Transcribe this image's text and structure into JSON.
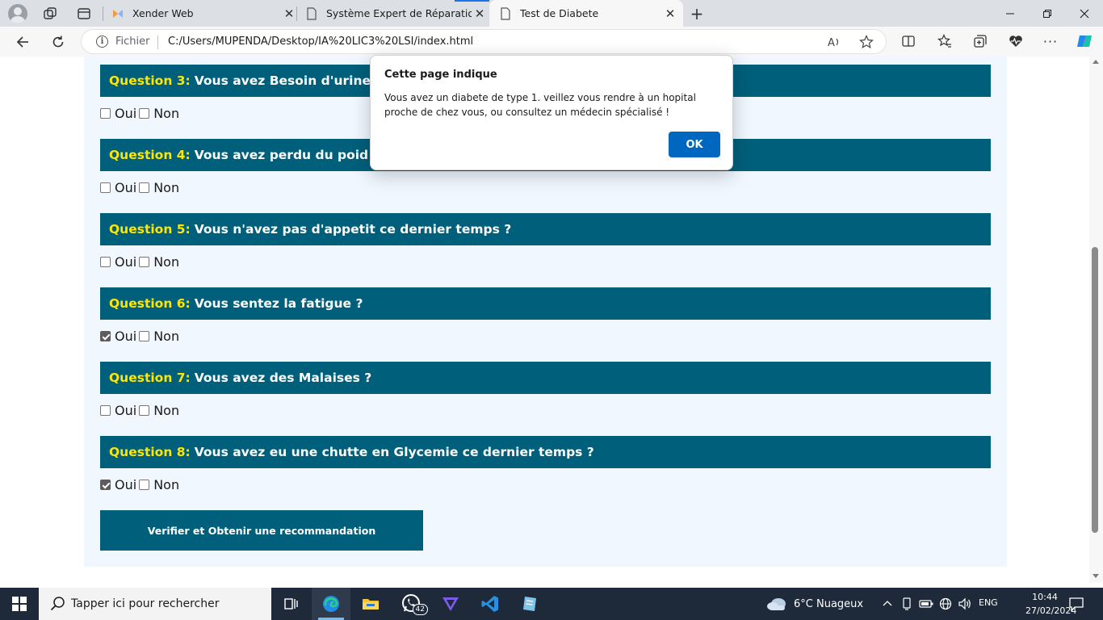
{
  "browser": {
    "tabs": [
      {
        "title": "Xender Web",
        "icon": "xender-icon"
      },
      {
        "title": "Système Expert de Réparation d'",
        "icon": "page-icon"
      },
      {
        "title": "Test de Diabete",
        "icon": "page-icon",
        "active": true
      }
    ],
    "address": {
      "scheme_label": "Fichier",
      "url": "C:/Users/MUPENDA/Desktop/IA%20LIC3%20LSI/index.html"
    }
  },
  "page": {
    "questions": [
      {
        "number_label": "Question 3:",
        "text": "Vous avez Besoin d'uriner ?",
        "oui_checked": false,
        "non_checked": false
      },
      {
        "number_label": "Question 4:",
        "text": "Vous avez perdu du poid ces d",
        "oui_checked": false,
        "non_checked": false
      },
      {
        "number_label": "Question 5:",
        "text": "Vous n'avez pas d'appetit ce dernier temps ?",
        "oui_checked": false,
        "non_checked": false
      },
      {
        "number_label": "Question 6:",
        "text": "Vous sentez la fatigue ?",
        "oui_checked": true,
        "non_checked": false
      },
      {
        "number_label": "Question 7:",
        "text": "Vous avez des Malaises ?",
        "oui_checked": false,
        "non_checked": false
      },
      {
        "number_label": "Question 8:",
        "text": "Vous avez eu une chutte en Glycemie ce dernier temps ?",
        "oui_checked": true,
        "non_checked": false
      }
    ],
    "answer_labels": {
      "oui": "Oui",
      "non": "Non"
    },
    "submit_label": "Verifier et Obtenir une recommandation"
  },
  "dialog": {
    "title": "Cette page indique",
    "message": "Vous avez un diabete de type 1. veillez vous rendre à un hopital proche de chez vous, ou consultez un médecin spécialisé !",
    "ok_label": "OK"
  },
  "taskbar": {
    "search_placeholder": "Tapper ici pour rechercher",
    "whatsapp_badge": "42",
    "weather": "6°C  Nuageux",
    "language": "ENG",
    "time": "10:44",
    "date": "27/02/2024"
  },
  "colors": {
    "header_bg": "#005f7a",
    "question_number": "#ffe600",
    "container_bg": "#f0f7ff",
    "ok_button": "#0067c0"
  }
}
